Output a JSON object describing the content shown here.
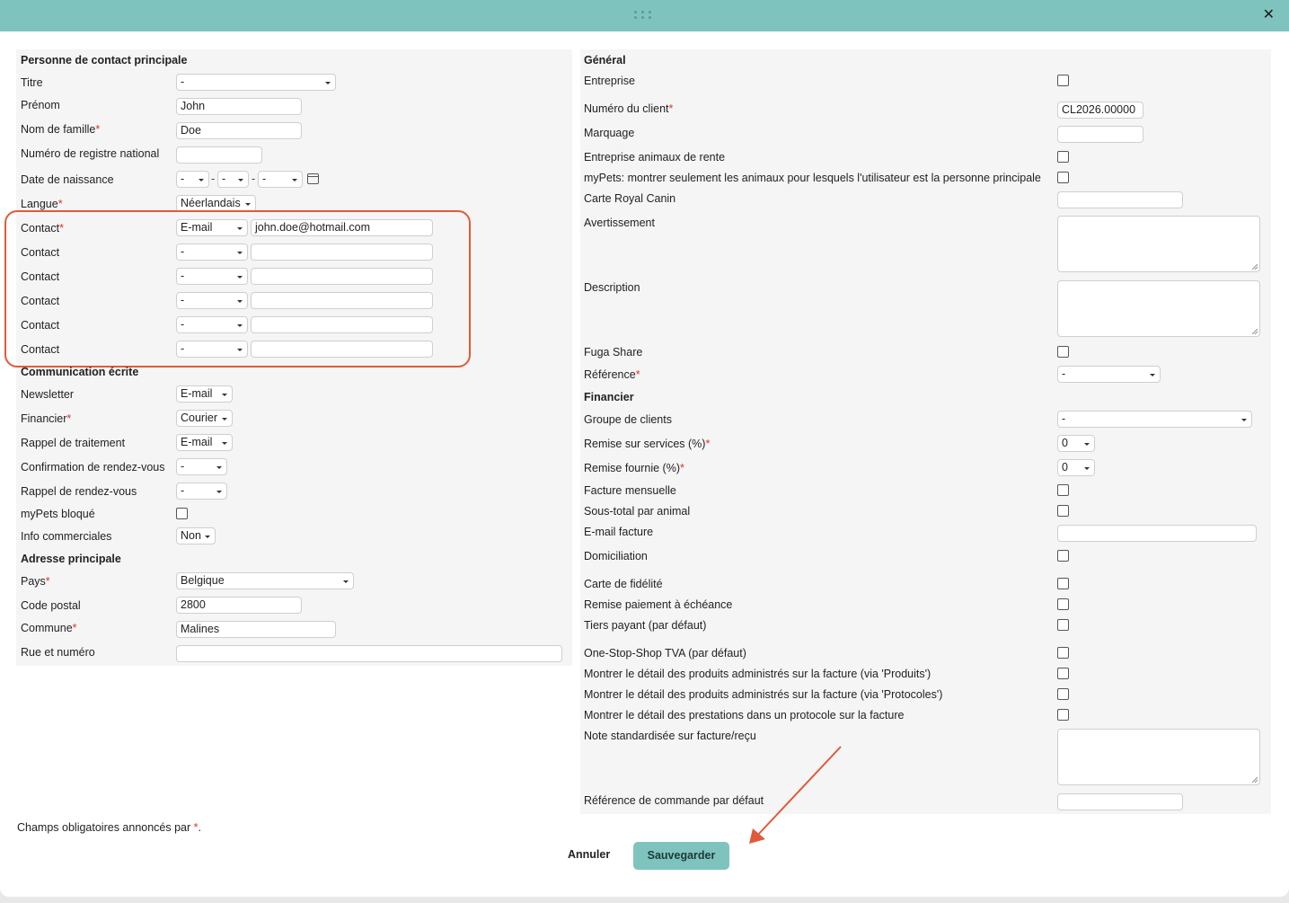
{
  "window": {
    "close_glyph": "✕",
    "grip_icon": "drag-handle-icon"
  },
  "left": {
    "section_contact": "Personne de contact principale",
    "titre_label": "Titre",
    "titre_value": "-",
    "prenom_label": "Prénom",
    "prenom_value": "John",
    "nom_label": "Nom de famille",
    "nom_value": "Doe",
    "registre_label": "Numéro de registre national",
    "registre_value": "",
    "naissance_label": "Date de naissance",
    "naissance_day": "-",
    "naissance_month": "-",
    "naissance_year": "-",
    "langue_label": "Langue",
    "langue_value": "Néerlandais",
    "contacts": [
      {
        "label": "Contact",
        "required": true,
        "type": "E-mail",
        "value": "john.doe@hotmail.com"
      },
      {
        "label": "Contact",
        "required": false,
        "type": "-",
        "value": ""
      },
      {
        "label": "Contact",
        "required": false,
        "type": "-",
        "value": ""
      },
      {
        "label": "Contact",
        "required": false,
        "type": "-",
        "value": ""
      },
      {
        "label": "Contact",
        "required": false,
        "type": "-",
        "value": ""
      },
      {
        "label": "Contact",
        "required": false,
        "type": "-",
        "value": ""
      }
    ],
    "section_comm": "Communication écrite",
    "newsletter_label": "Newsletter",
    "newsletter_value": "E-mail",
    "financier_label": "Financier",
    "financier_value": "Courier",
    "rappel_trait_label": "Rappel de traitement",
    "rappel_trait_value": "E-mail",
    "confirm_rdv_label": "Confirmation de rendez-vous",
    "confirm_rdv_value": "-",
    "rappel_rdv_label": "Rappel de rendez-vous",
    "rappel_rdv_value": "-",
    "mypets_label": "myPets bloqué",
    "info_comm_label": "Info commerciales",
    "info_comm_value": "Non",
    "section_adresse": "Adresse principale",
    "pays_label": "Pays",
    "pays_value": "Belgique",
    "cp_label": "Code postal",
    "cp_value": "2800",
    "commune_label": "Commune",
    "commune_value": "Malines",
    "rue_label": "Rue et numéro",
    "rue_value": ""
  },
  "right": {
    "section_general": "Général",
    "entreprise_label": "Entreprise",
    "num_client_label": "Numéro du client",
    "num_client_value": "CL2026.00000",
    "marquage_label": "Marquage",
    "rente_label": "Entreprise animaux de rente",
    "mypets_label": "myPets: montrer seulement les animaux pour lesquels l'utilisateur est la personne principale",
    "royal_label": "Carte Royal Canin",
    "avert_label": "Avertissement",
    "desc_label": "Description",
    "fuga_label": "Fuga Share",
    "ref_label": "Référence",
    "ref_value": "-",
    "section_fin": "Financier",
    "groupe_label": "Groupe de clients",
    "groupe_value": "-",
    "remise_serv_label": "Remise sur services (%)",
    "remise_serv_value": "0",
    "remise_four_label": "Remise fournie (%)",
    "remise_four_value": "0",
    "facture_mens_label": "Facture mensuelle",
    "sous_total_label": "Sous-total par animal",
    "email_fact_label": "E-mail facture",
    "domic_label": "Domiciliation",
    "fidel_label": "Carte de fidélité",
    "remise_paie_label": "Remise paiement à échéance",
    "tiers_label": "Tiers payant (par défaut)",
    "oss_label": "One-Stop-Shop TVA (par défaut)",
    "detail_prod_label": "Montrer le détail des produits administrés sur la facture (via 'Produits')",
    "detail_proto_label": "Montrer le détail des produits administrés sur la facture (via 'Protocoles')",
    "detail_prest_label": "Montrer le détail des prestations dans un protocole sur la facture",
    "note_label": "Note standardisée sur facture/reçu",
    "ref_cmd_label": "Référence de commande par défaut"
  },
  "footer": {
    "note_text": "Champs obligatoires annoncés par ",
    "note_star": "*",
    "note_end": ".",
    "cancel_label": "Annuler",
    "save_label": "Sauvegarder"
  },
  "colors": {
    "header": "#7fc3bf",
    "required": "#d9352a",
    "highlight": "#e05a3a"
  }
}
